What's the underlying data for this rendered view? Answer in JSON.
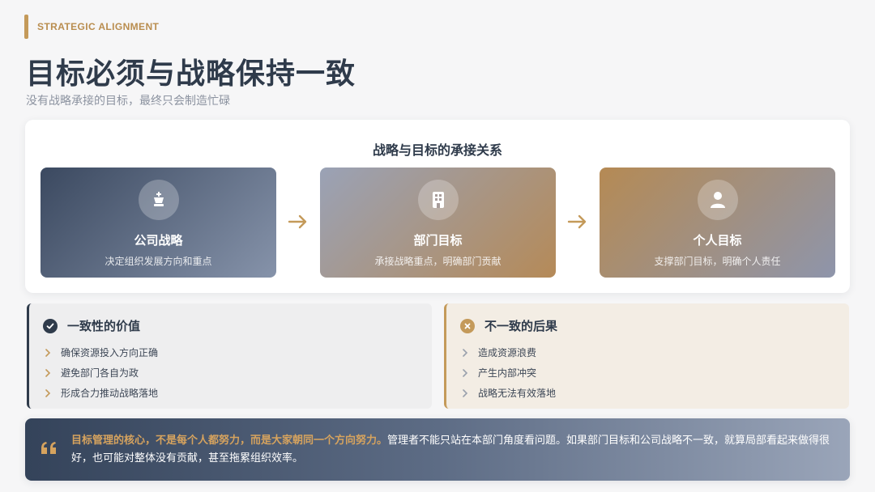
{
  "header": {
    "tag": "STRATEGIC ALIGNMENT",
    "title": "目标必须与战略保持一致",
    "subtitle": "没有战略承接的目标，最终只会制造忙碌"
  },
  "flow": {
    "title": "战略与目标的承接关系",
    "steps": [
      {
        "title": "公司战略",
        "desc": "决定组织发展方向和重点",
        "icon": "chess-king-icon"
      },
      {
        "title": "部门目标",
        "desc": "承接战略重点，明确部门贡献",
        "icon": "building-icon"
      },
      {
        "title": "个人目标",
        "desc": "支撑部门目标，明确个人责任",
        "icon": "user-icon"
      }
    ]
  },
  "consistent": {
    "title": "一致性的价值",
    "items": [
      "确保资源投入方向正确",
      "避免部门各自为政",
      "形成合力推动战略落地"
    ]
  },
  "inconsistent": {
    "title": "不一致的后果",
    "items": [
      "造成资源浪费",
      "产生内部冲突",
      "战略无法有效落地"
    ]
  },
  "quote": {
    "highlight": "目标管理的核心，不是每个人都努力，而是大家朝同一个方向努力。",
    "body": "管理者不能只站在本部门角度看问题。如果部门目标和公司战略不一致，就算局部看起来做得很好，也可能对整体没有贡献，甚至拖累组织效率。"
  },
  "colors": {
    "accent_gold": "#c49a5a",
    "dark_navy": "#2f3b4b",
    "quote_highlight": "#d6a35e"
  }
}
